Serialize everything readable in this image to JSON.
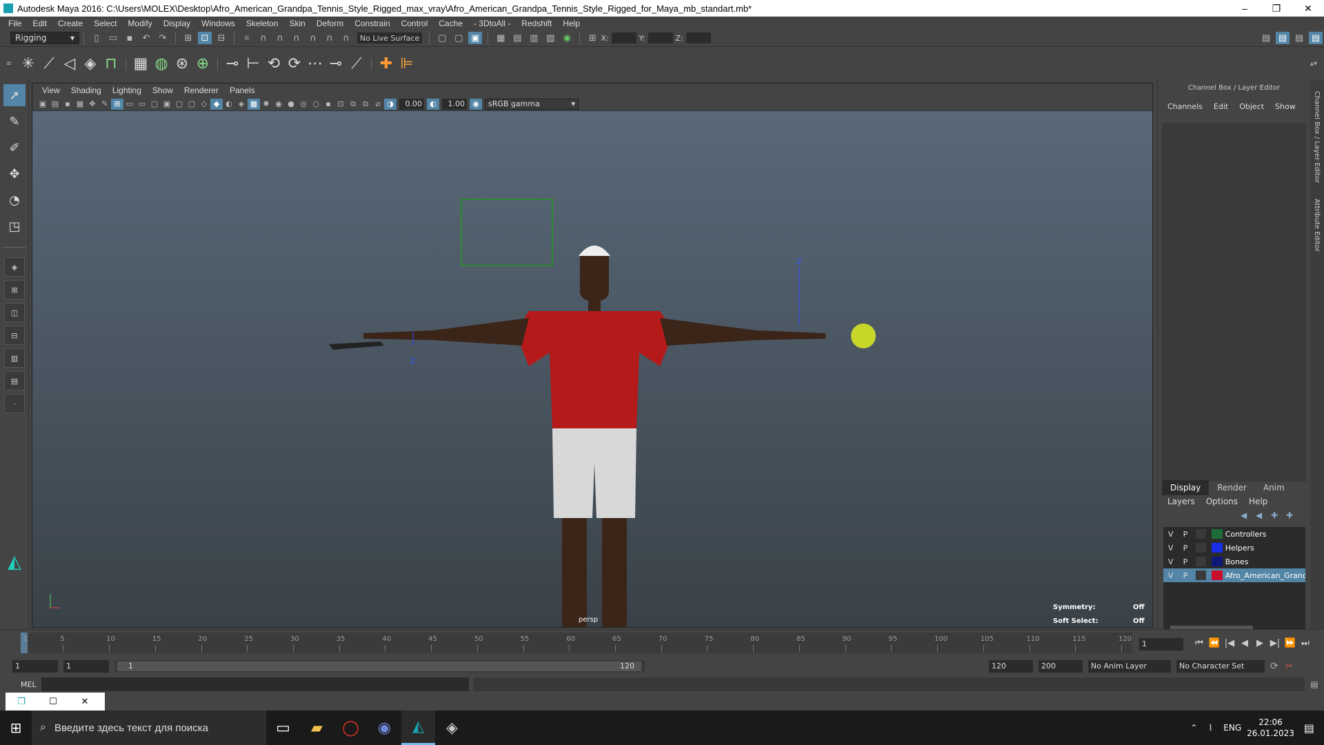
{
  "window": {
    "title": "Autodesk Maya 2016: C:\\Users\\MOLEX\\Desktop\\Afro_American_Grandpa_Tennis_Style_Rigged_max_vray\\Afro_American_Grandpa_Tennis_Style_Rigged_for_Maya_mb_standart.mb*",
    "minimize": "–",
    "maximize": "❐",
    "close": "✕"
  },
  "menu": [
    "File",
    "Edit",
    "Create",
    "Select",
    "Modify",
    "Display",
    "Windows",
    "Skeleton",
    "Skin",
    "Deform",
    "Constrain",
    "Control",
    "Cache",
    "- 3DtoAll -",
    "Redshift",
    "Help"
  ],
  "statusline": {
    "mode": "Rigging",
    "live_surface": "No Live Surface",
    "x_label": "X:",
    "y_label": "Y:",
    "z_label": "Z:"
  },
  "viewport": {
    "menu": [
      "View",
      "Shading",
      "Lighting",
      "Show",
      "Renderer",
      "Panels"
    ],
    "gamma_value": "0.00",
    "exposure_value": "1.00",
    "color_space": "sRGB gamma",
    "camera": "persp",
    "hud": {
      "symmetry_label": "Symmetry:",
      "symmetry_value": "Off",
      "soft_select_label": "Soft Select:",
      "soft_select_value": "Off"
    },
    "axis_labels": [
      "Z",
      "Z",
      "Z"
    ]
  },
  "channel_box": {
    "title": "Channel Box / Layer Editor",
    "menu": [
      "Channels",
      "Edit",
      "Object",
      "Show"
    ]
  },
  "layer_editor": {
    "tabs": [
      "Display",
      "Render",
      "Anim"
    ],
    "menu": [
      "Layers",
      "Options",
      "Help"
    ],
    "layers": [
      {
        "v": "V",
        "p": "P",
        "name": "Controllers",
        "color": "#1e6b3a"
      },
      {
        "v": "V",
        "p": "P",
        "name": "Helpers",
        "color": "#1a2ee8"
      },
      {
        "v": "V",
        "p": "P",
        "name": "Bones",
        "color": "#0d1a7a"
      },
      {
        "v": "V",
        "p": "P",
        "name": "Afro_American_Grandpa",
        "color": "#c8102e"
      }
    ]
  },
  "side_tabs": [
    "Channel Box / Layer Editor",
    "Attribute Editor"
  ],
  "timeline": {
    "ticks": [
      "1",
      "5",
      "10",
      "15",
      "20",
      "25",
      "30",
      "35",
      "40",
      "45",
      "50",
      "55",
      "60",
      "65",
      "70",
      "75",
      "80",
      "85",
      "90",
      "95",
      "100",
      "105",
      "110",
      "115",
      "120"
    ],
    "current_frame": "1",
    "play": [
      "⏮",
      "⏪",
      "|◀",
      "◀",
      "▶",
      "▶|",
      "⏩",
      "⏭"
    ]
  },
  "range": {
    "start": "1",
    "anim_start": "1",
    "slider_start": "1",
    "slider_end": "120",
    "end": "120",
    "anim_end": "200",
    "anim_layer": "No Anim Layer",
    "character_set": "No Character Set"
  },
  "cmdline": {
    "label": "MEL"
  },
  "mini_window": {
    "restore": "❐",
    "maximize": "☐",
    "close": "✕"
  },
  "taskbar": {
    "search_placeholder": "Введите здесь текст для поиска",
    "lang": "ENG",
    "time": "22:06",
    "date": "26.01.2023"
  }
}
